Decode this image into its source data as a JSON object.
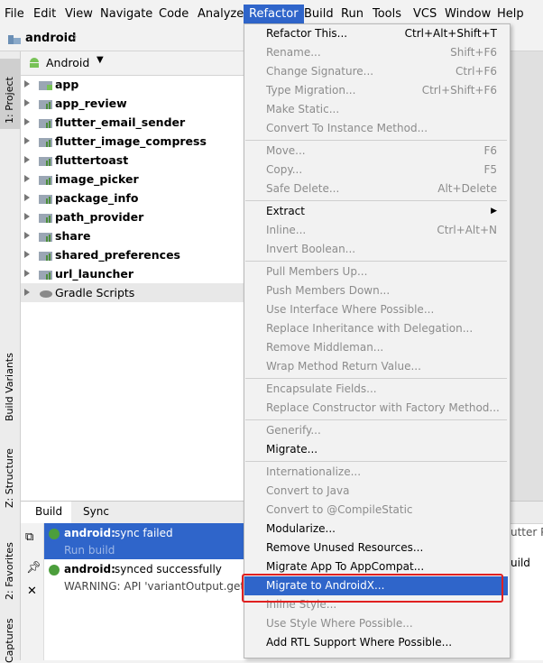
{
  "menubar": {
    "items": [
      "File",
      "Edit",
      "View",
      "Navigate",
      "Code",
      "Analyze",
      "Refactor",
      "Build",
      "Run",
      "Tools",
      "VCS",
      "Window",
      "Help"
    ],
    "active": "Refactor"
  },
  "breadcrumb": {
    "project": "android"
  },
  "sidebar": {
    "tabs": [
      "1: Project",
      "Build Variants",
      "Z: Structure",
      "2: Favorites",
      "Captures"
    ]
  },
  "project": {
    "view_selector": "Android",
    "tree": [
      {
        "label": "app",
        "kind": "app"
      },
      {
        "label": "app_review",
        "kind": "module"
      },
      {
        "label": "flutter_email_sender",
        "kind": "module"
      },
      {
        "label": "flutter_image_compress",
        "kind": "module"
      },
      {
        "label": "fluttertoast",
        "kind": "module"
      },
      {
        "label": "image_picker",
        "kind": "module"
      },
      {
        "label": "package_info",
        "kind": "module"
      },
      {
        "label": "path_provider",
        "kind": "module"
      },
      {
        "label": "share",
        "kind": "module"
      },
      {
        "label": "shared_preferences",
        "kind": "module"
      },
      {
        "label": "url_launcher",
        "kind": "module"
      },
      {
        "label": "Gradle Scripts",
        "kind": "gradle"
      }
    ]
  },
  "bottom": {
    "tabs": [
      "Build",
      "Sync"
    ],
    "entries": [
      {
        "title": "android:",
        "text": "sync failed",
        "sub": "Run build",
        "selected": true
      },
      {
        "title": "android:",
        "text": "synced successfully",
        "sub": "WARNING: API 'variantOutput.getP",
        "selected": false
      }
    ],
    "right_text": [
      "utter P",
      "uild"
    ]
  },
  "menu": {
    "items": [
      {
        "label": "Refactor This...",
        "shortcut": "Ctrl+Alt+Shift+T",
        "enabled": true
      },
      {
        "label": "Rename...",
        "shortcut": "Shift+F6",
        "enabled": false
      },
      {
        "label": "Change Signature...",
        "shortcut": "Ctrl+F6",
        "enabled": false
      },
      {
        "label": "Type Migration...",
        "shortcut": "Ctrl+Shift+F6",
        "enabled": false
      },
      {
        "label": "Make Static...",
        "shortcut": "",
        "enabled": false
      },
      {
        "label": "Convert To Instance Method...",
        "shortcut": "",
        "enabled": false
      },
      {
        "sep": true
      },
      {
        "label": "Move...",
        "shortcut": "F6",
        "enabled": false
      },
      {
        "label": "Copy...",
        "shortcut": "F5",
        "enabled": false
      },
      {
        "label": "Safe Delete...",
        "shortcut": "Alt+Delete",
        "enabled": false
      },
      {
        "sep": true
      },
      {
        "label": "Extract",
        "shortcut": "",
        "enabled": true,
        "submenu": true
      },
      {
        "label": "Inline...",
        "shortcut": "Ctrl+Alt+N",
        "enabled": false
      },
      {
        "label": "Invert Boolean...",
        "shortcut": "",
        "enabled": false
      },
      {
        "sep": true
      },
      {
        "label": "Pull Members Up...",
        "shortcut": "",
        "enabled": false
      },
      {
        "label": "Push Members Down...",
        "shortcut": "",
        "enabled": false
      },
      {
        "label": "Use Interface Where Possible...",
        "shortcut": "",
        "enabled": false
      },
      {
        "label": "Replace Inheritance with Delegation...",
        "shortcut": "",
        "enabled": false
      },
      {
        "label": "Remove Middleman...",
        "shortcut": "",
        "enabled": false
      },
      {
        "label": "Wrap Method Return Value...",
        "shortcut": "",
        "enabled": false
      },
      {
        "sep": true
      },
      {
        "label": "Encapsulate Fields...",
        "shortcut": "",
        "enabled": false
      },
      {
        "label": "Replace Constructor with Factory Method...",
        "shortcut": "",
        "enabled": false
      },
      {
        "sep": true
      },
      {
        "label": "Generify...",
        "shortcut": "",
        "enabled": false
      },
      {
        "label": "Migrate...",
        "shortcut": "",
        "enabled": true
      },
      {
        "sep": true
      },
      {
        "label": "Internationalize...",
        "shortcut": "",
        "enabled": false
      },
      {
        "label": "Convert to Java",
        "shortcut": "",
        "enabled": false
      },
      {
        "label": "Convert to @CompileStatic",
        "shortcut": "",
        "enabled": false
      },
      {
        "label": "Modularize...",
        "shortcut": "",
        "enabled": true
      },
      {
        "label": "Remove Unused Resources...",
        "shortcut": "",
        "enabled": true
      },
      {
        "label": "Migrate App To AppCompat...",
        "shortcut": "",
        "enabled": true
      },
      {
        "label": "Migrate to AndroidX...",
        "shortcut": "",
        "enabled": true,
        "selected": true
      },
      {
        "label": "Inline Style...",
        "shortcut": "",
        "enabled": false
      },
      {
        "label": "Use Style Where Possible...",
        "shortcut": "",
        "enabled": false
      },
      {
        "label": "Add RTL Support Where Possible...",
        "shortcut": "",
        "enabled": true
      }
    ]
  },
  "colors": {
    "accent": "#2f65ca",
    "highlight": "#e02020",
    "android_green": "#78c257"
  }
}
